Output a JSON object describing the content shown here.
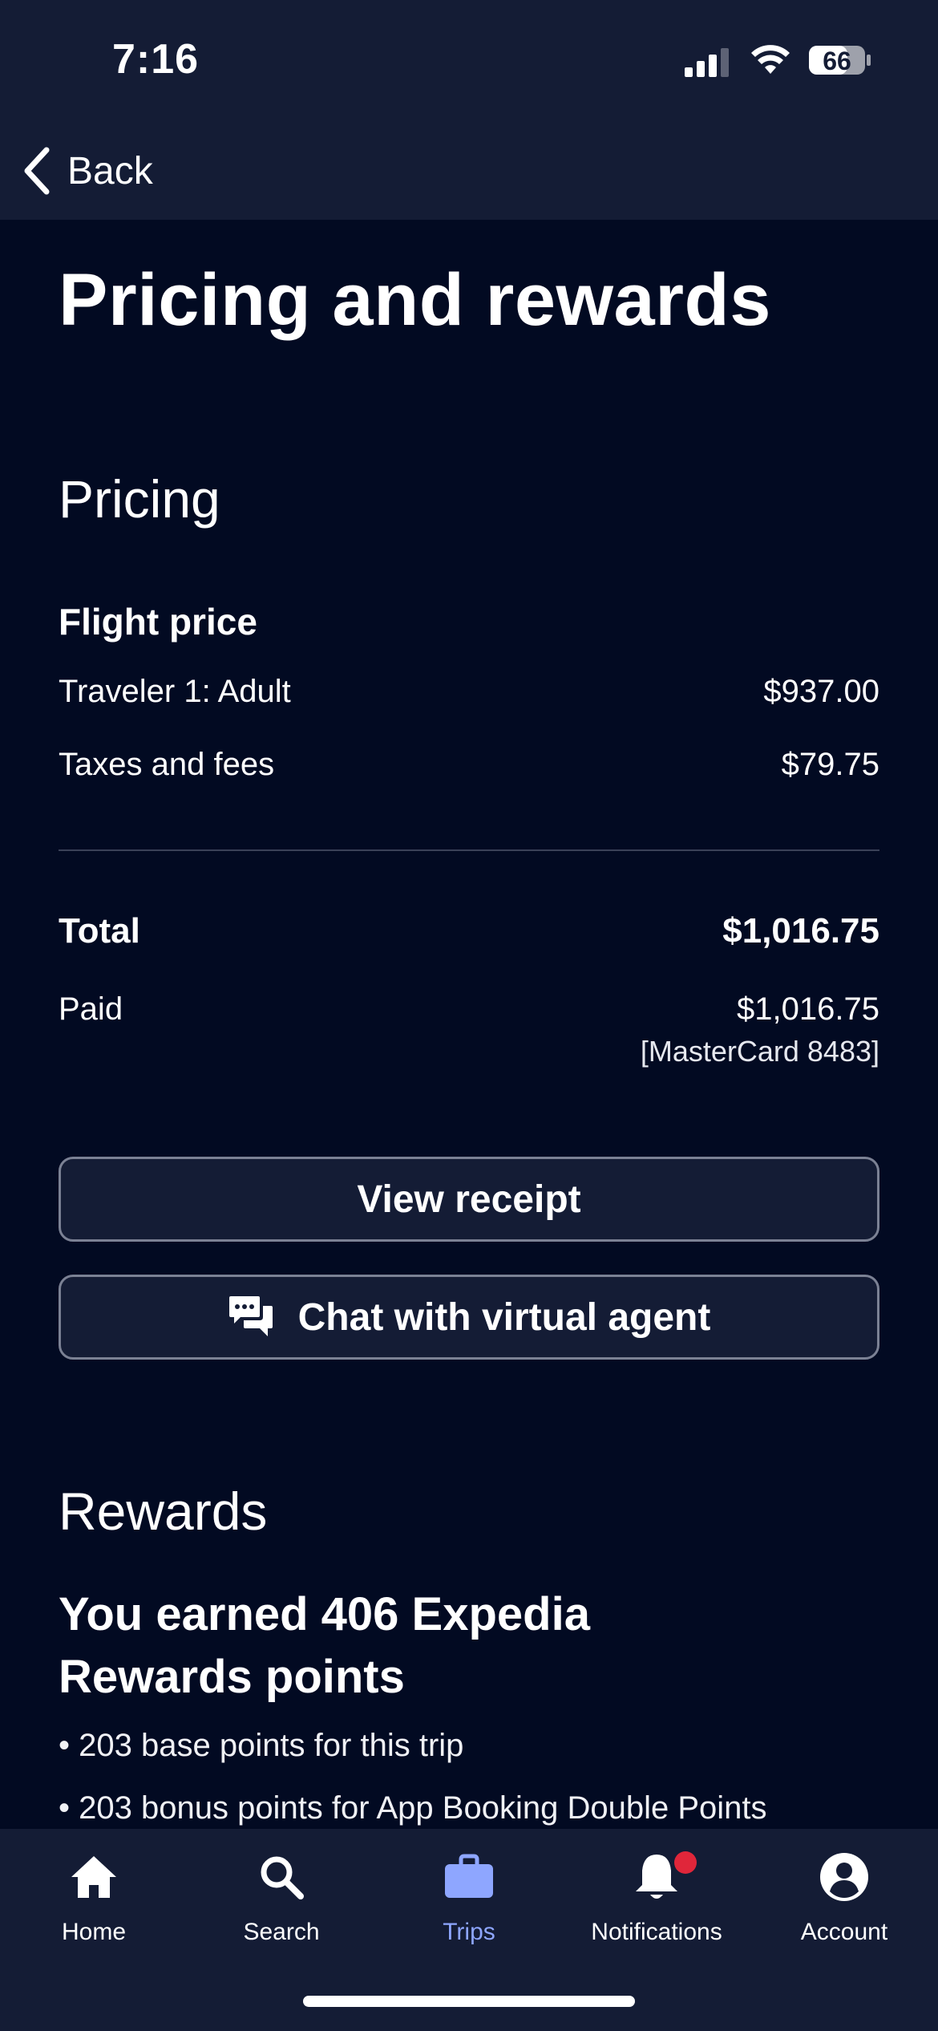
{
  "status": {
    "time": "7:16",
    "battery": "66"
  },
  "nav": {
    "back_label": "Back"
  },
  "page_title": "Pricing and rewards",
  "pricing": {
    "section_title": "Pricing",
    "flight_price_label": "Flight price",
    "lines": [
      {
        "label": "Traveler 1: Adult",
        "value": "$937.00"
      },
      {
        "label": "Taxes and fees",
        "value": "$79.75"
      }
    ],
    "total_label": "Total",
    "total_value": "$1,016.75",
    "paid_label": "Paid",
    "paid_value": "$1,016.75",
    "payment_method": "[MasterCard 8483]"
  },
  "buttons": {
    "view_receipt": "View receipt",
    "chat_agent": "Chat with virtual agent"
  },
  "rewards": {
    "section_title": "Rewards",
    "headline_line1": "You earned 406 Expedia",
    "headline_line2": "Rewards points",
    "bullets": [
      "• 203 base points for this trip",
      "• 203 bonus points for App Booking Double Points"
    ]
  },
  "tabs": [
    {
      "label": "Home",
      "icon": "home-icon"
    },
    {
      "label": "Search",
      "icon": "search-icon"
    },
    {
      "label": "Trips",
      "icon": "briefcase-icon",
      "active": true
    },
    {
      "label": "Notifications",
      "icon": "bell-icon",
      "badge": true
    },
    {
      "label": "Account",
      "icon": "account-icon"
    }
  ],
  "colors": {
    "background": "#020a22",
    "bar": "#141c35",
    "accent": "#8ea6ff",
    "badge": "#e0263a"
  }
}
